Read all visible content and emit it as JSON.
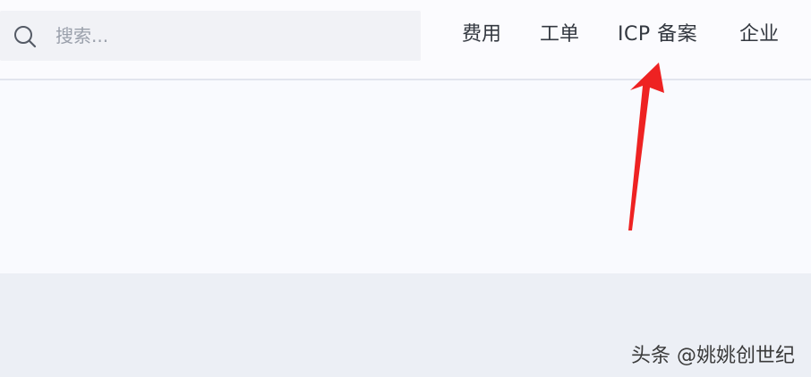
{
  "search": {
    "placeholder": "搜索..."
  },
  "nav": {
    "items": [
      {
        "label": "费用"
      },
      {
        "label": "工单"
      },
      {
        "label": "ICP 备案"
      },
      {
        "label": "企业"
      }
    ]
  },
  "annotation": {
    "arrow_color": "#ee2222",
    "points_to": "ICP 备案"
  },
  "watermark": {
    "text": "头条 @姚姚创世纪"
  },
  "colors": {
    "header_bg": "#fbfbfe",
    "search_bg": "#f1f2f6",
    "page_bg": "#f9fafe",
    "lower_bg": "#eceff5",
    "nav_text": "#333840"
  }
}
